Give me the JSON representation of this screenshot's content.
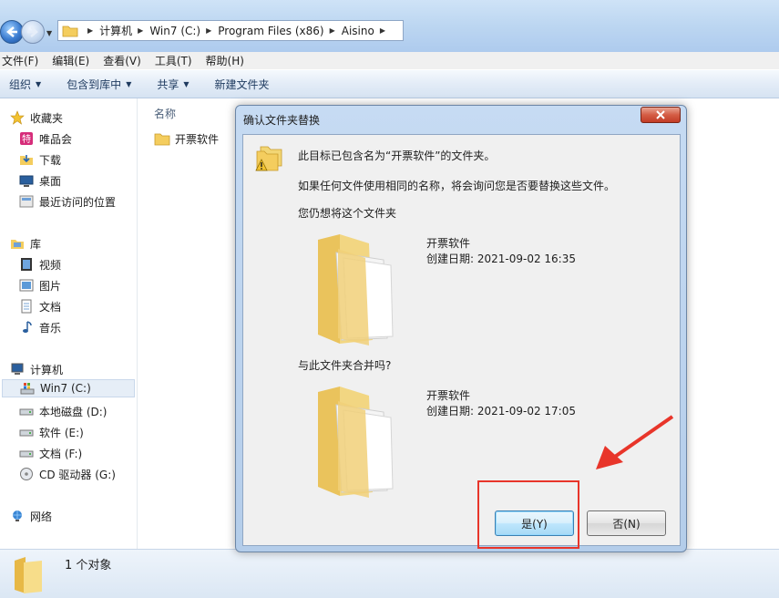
{
  "address": {
    "crumbs": [
      "计算机",
      "Win7 (C:)",
      "Program Files (x86)",
      "Aisino"
    ]
  },
  "menu": [
    "文件(F)",
    "编辑(E)",
    "查看(V)",
    "工具(T)",
    "帮助(H)"
  ],
  "toolbar": {
    "organize": "组织",
    "include_library": "包含到库中",
    "share": "共享",
    "new_folder": "新建文件夹"
  },
  "sidebar": {
    "favorites": "收藏夹",
    "vip": "唯品会",
    "downloads": "下载",
    "desktop": "桌面",
    "recent": "最近访问的位置",
    "libraries": "库",
    "videos": "视频",
    "pictures": "图片",
    "documents": "文档",
    "music": "音乐",
    "computer": "计算机",
    "drive_c": "Win7 (C:)",
    "drive_d": "本地磁盘 (D:)",
    "drive_e": "软件 (E:)",
    "drive_f": "文档 (F:)",
    "drive_g": "CD 驱动器 (G:)",
    "network": "网络"
  },
  "content": {
    "column_name": "名称",
    "item": "开票软件"
  },
  "status": {
    "count": "1 个对象"
  },
  "dialog": {
    "title": "确认文件夹替换",
    "line1": "此目标已包含名为“开票软件”的文件夹。",
    "line2": "如果任何文件使用相同的名称，将会询问您是否要替换这些文件。",
    "line3": "您仍想将这个文件夹",
    "folder1_name": "开票软件",
    "folder1_date": "创建日期: 2021-09-02 16:35",
    "merge_question": "与此文件夹合并吗?",
    "folder2_name": "开票软件",
    "folder2_date": "创建日期: 2021-09-02 17:05",
    "yes_label": "是(Y)",
    "no_label": "否(N)"
  },
  "colors": {
    "annotation": "#e8352a",
    "dialog_frame": "#b4cdea"
  }
}
